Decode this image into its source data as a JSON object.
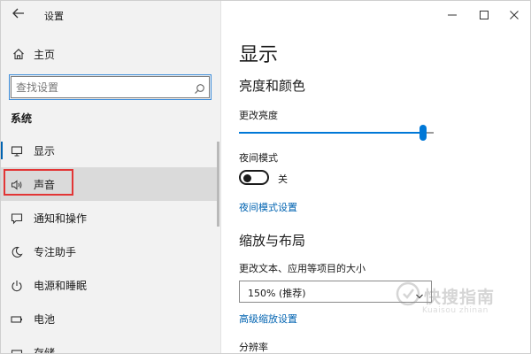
{
  "window": {
    "title": "设置"
  },
  "sidebar": {
    "home_label": "主页",
    "search_placeholder": "查找设置",
    "section_label": "系统",
    "items": [
      {
        "label": "显示",
        "icon": "monitor-icon",
        "selected": true
      },
      {
        "label": "声音",
        "icon": "speaker-icon",
        "highlighted": true
      },
      {
        "label": "通知和操作",
        "icon": "notification-icon"
      },
      {
        "label": "专注助手",
        "icon": "moon-icon"
      },
      {
        "label": "电源和睡眠",
        "icon": "power-icon"
      },
      {
        "label": "电池",
        "icon": "battery-icon"
      },
      {
        "label": "存储",
        "icon": "storage-icon"
      }
    ]
  },
  "main": {
    "title": "显示",
    "brightness_section": "亮度和颜色",
    "brightness_label": "更改亮度",
    "brightness_value": 0.96,
    "night_mode_label": "夜间模式",
    "night_mode_state": "关",
    "night_mode_settings_link": "夜间模式设置",
    "scale_section": "缩放与布局",
    "scale_label": "更改文本、应用等项目的大小",
    "scale_value": "150% (推荐)",
    "advanced_scale_link": "高级缩放设置",
    "resolution_label": "分辨率"
  },
  "watermark": {
    "text": "快搜指南",
    "sub": "Kuaisou zhinan"
  },
  "colors": {
    "accent": "#0078d7",
    "link": "#0063b1",
    "highlight_box": "#e23535",
    "sidebar_bg": "#f2f2f2"
  }
}
